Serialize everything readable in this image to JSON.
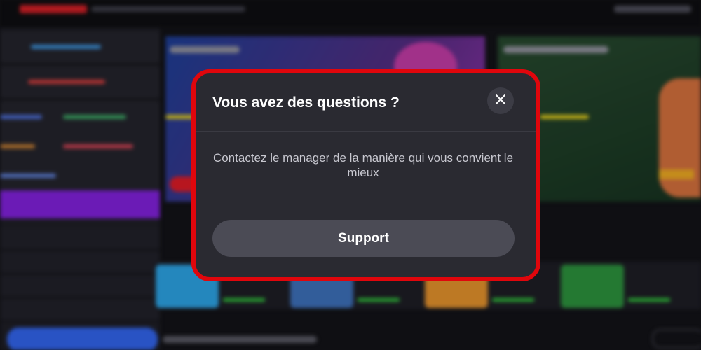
{
  "modal": {
    "title": "Vous avez des questions ?",
    "message": "Contactez le manager de la manière qui vous convient le mieux",
    "support_label": "Support",
    "close_icon": "close-icon",
    "highlight_color": "#e0060c"
  }
}
